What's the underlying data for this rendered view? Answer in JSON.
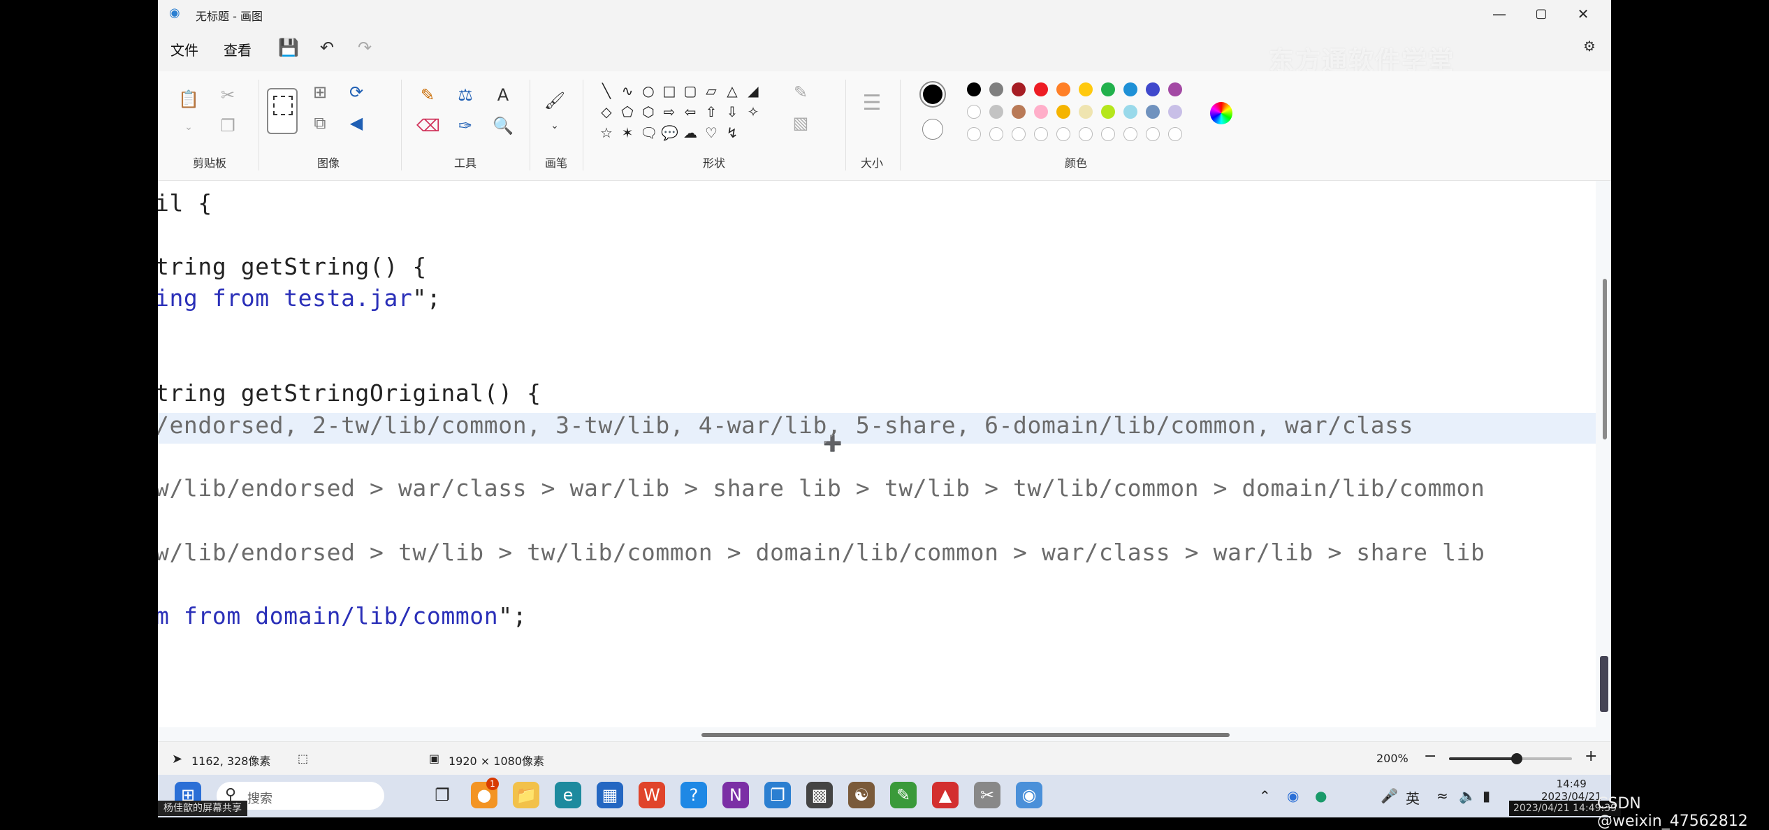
{
  "window": {
    "title": "无标题 - 画图",
    "controls": {
      "minimize": "—",
      "maximize": "▢",
      "close": "✕"
    }
  },
  "menu": {
    "file": "文件",
    "view": "查看"
  },
  "watermark": "东方通软件学堂",
  "ribbon": {
    "groups": {
      "clipboard": "剪贴板",
      "image": "图像",
      "tools": "工具",
      "brushes": "画笔",
      "shapes": "形状",
      "size": "大小",
      "colors": "颜色"
    },
    "palette_row1": [
      "#000000",
      "#7f7f7f",
      "#a61d24",
      "#ed1c24",
      "#ff7f27",
      "#ffc90e",
      "#22b14c",
      "#1e90d6",
      "#3f48cc",
      "#a349a4"
    ],
    "palette_row2": [
      "#ffffff",
      "#c3c3c3",
      "#b97a57",
      "#ffaec9",
      "#f5b400",
      "#efe4b0",
      "#b5e61d",
      "#99d9ea",
      "#7092be",
      "#c8bfe7"
    ],
    "primary_color": "#000000",
    "secondary_color": "#ffffff"
  },
  "canvas": {
    "lines": [
      {
        "text": "il {",
        "style": "dark"
      },
      {
        "text": "tring getString() {",
        "style": "dark"
      },
      {
        "pre": "ing from testa.jar",
        "post": "\";",
        "style": "blue"
      },
      {
        "text": "tring getStringOriginal() {",
        "style": "dark"
      },
      {
        "text": "/endorsed, 2-tw/lib/common, 3-tw/lib, 4-war/lib, 5-share, 6-domain/lib/common, war/class",
        "style": "gray"
      },
      {
        "text": "w/lib/endorsed > war/class > war/lib > share lib > tw/lib > tw/lib/common > domain/lib/common",
        "style": "gray"
      },
      {
        "text": "w/lib/endorsed > tw/lib > tw/lib/common > domain/lib/common > war/class > war/lib > share lib",
        "style": "gray"
      },
      {
        "pre": "m from domain/lib/common",
        "post": "\";",
        "style": "blue"
      }
    ]
  },
  "status": {
    "cursor_pos": "1162, 328像素",
    "canvas_size": "1920 × 1080像素",
    "zoom": "200%",
    "zoom_fraction": 0.55
  },
  "taskbar": {
    "search_placeholder": "搜索",
    "badge": "1",
    "ime": "英",
    "time": "14:49",
    "date": "2023/04/21"
  },
  "overlay": {
    "share_text": "杨佳歆的屏幕共享",
    "csdn": "CSDN @weixin_47562812",
    "timestamp": "2023/04/21 14:49:39"
  }
}
